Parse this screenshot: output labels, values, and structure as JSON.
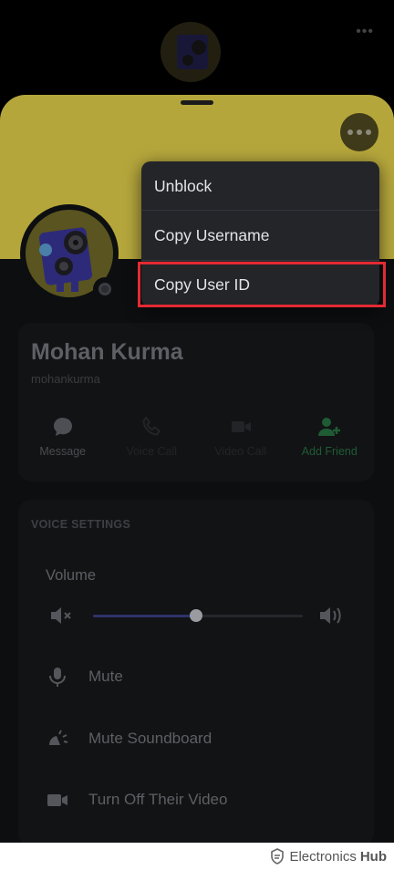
{
  "profile": {
    "display_name": "Mohan Kurma",
    "username": "mohankurma"
  },
  "actions": [
    {
      "label": "Message",
      "icon": "message-icon"
    },
    {
      "label": "Voice Call",
      "icon": "phone-icon"
    },
    {
      "label": "Video Call",
      "icon": "video-icon"
    },
    {
      "label": "Add Friend",
      "icon": "add-friend-icon"
    }
  ],
  "voice_settings": {
    "title": "VOICE SETTINGS",
    "volume_label": "Volume",
    "volume_level": 0.49,
    "options": [
      {
        "label": "Mute",
        "icon": "microphone-icon"
      },
      {
        "label": "Mute Soundboard",
        "icon": "soundboard-icon"
      },
      {
        "label": "Turn Off Their Video",
        "icon": "video-off-icon"
      }
    ]
  },
  "context_menu": {
    "items": [
      {
        "label": "Unblock"
      },
      {
        "label": "Copy Username"
      },
      {
        "label": "Copy User ID"
      }
    ],
    "highlighted_index": 2
  },
  "watermark": {
    "part1": "Electronics",
    "part2": "Hub"
  },
  "colors": {
    "banner": "#b5a63c",
    "highlight_border": "#e42a33",
    "add_friend": "#1f5b34",
    "menu_bg": "#242529"
  }
}
